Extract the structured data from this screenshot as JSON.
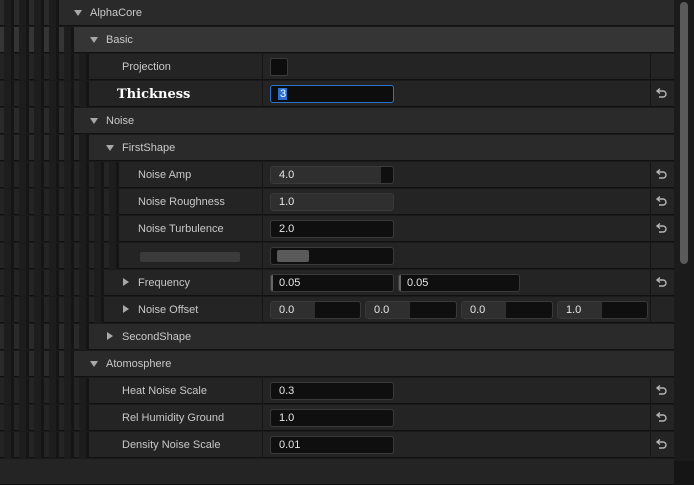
{
  "categories": {
    "alphacore": "AlphaCore",
    "basic": "Basic",
    "noise": "Noise",
    "first_shape": "FirstShape",
    "second_shape": "SecondShape",
    "atmosphere": "Atomosphere"
  },
  "properties": {
    "projection": {
      "label": "Projection"
    },
    "thickness": {
      "label": "Thickness",
      "value": "3"
    },
    "noise_amp": {
      "label": "Noise Amp",
      "value": "4.0",
      "fill": 0.9
    },
    "noise_roughness": {
      "label": "Noise Roughness",
      "value": "1.0",
      "fill": 1.0
    },
    "noise_turbulence": {
      "label": "Noise Turbulence",
      "value": "2.0",
      "fill": 0.0
    },
    "frequency": {
      "label": "Frequency",
      "values": [
        "0.05",
        "0.05"
      ]
    },
    "noise_offset": {
      "label": "Noise Offset",
      "values": [
        "0.0",
        "0.0",
        "0.0",
        "1.0"
      ]
    },
    "heat_noise_scale": {
      "label": "Heat Noise Scale",
      "value": "0.3"
    },
    "rel_humidity_ground": {
      "label": "Rel Humidity Ground",
      "value": "1.0"
    },
    "density_noise_scale": {
      "label": "Density Noise Scale",
      "value": "0.01"
    }
  },
  "icons": {
    "reset": "reset-to-default-icon",
    "expand": "chevron-down-icon",
    "collapse": "chevron-right-icon"
  },
  "colors": {
    "selection": "#2a6ed1",
    "focus_border": "#2b73c8"
  }
}
